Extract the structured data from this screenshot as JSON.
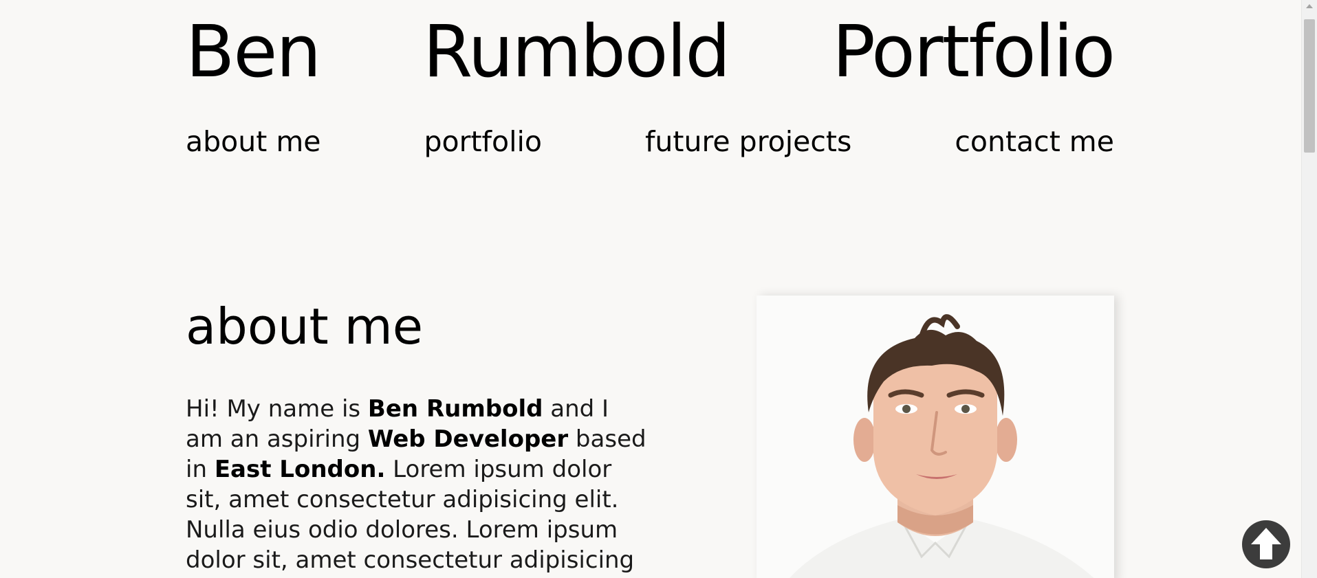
{
  "header": {
    "title_words": [
      "Ben",
      "Rumbold",
      "Portfolio"
    ]
  },
  "nav": {
    "items": [
      {
        "label": "about me"
      },
      {
        "label": "portfolio"
      },
      {
        "label": "future projects"
      },
      {
        "label": "contact me"
      }
    ]
  },
  "about": {
    "heading": "about me",
    "text": {
      "p1": "Hi! My name is ",
      "name": "Ben Rumbold",
      "p2": " and I am an aspiring ",
      "role": "Web Developer",
      "p3": " based in ",
      "location": "East London.",
      "p4": " Lorem ipsum dolor sit, amet consectetur adipisicing elit. Nulla eius odio dolores. Lorem ipsum dolor sit, amet consectetur adipisicing elit."
    },
    "portrait_icon": "portrait-photo"
  },
  "controls": {
    "back_to_top_icon": "arrow-up-circle-icon"
  },
  "colors": {
    "background": "#f9f8f6",
    "text": "#000000",
    "scrollbar_track": "#f1f1f1",
    "scrollbar_thumb": "#c1c1c1",
    "button": "#3c3c3c"
  }
}
